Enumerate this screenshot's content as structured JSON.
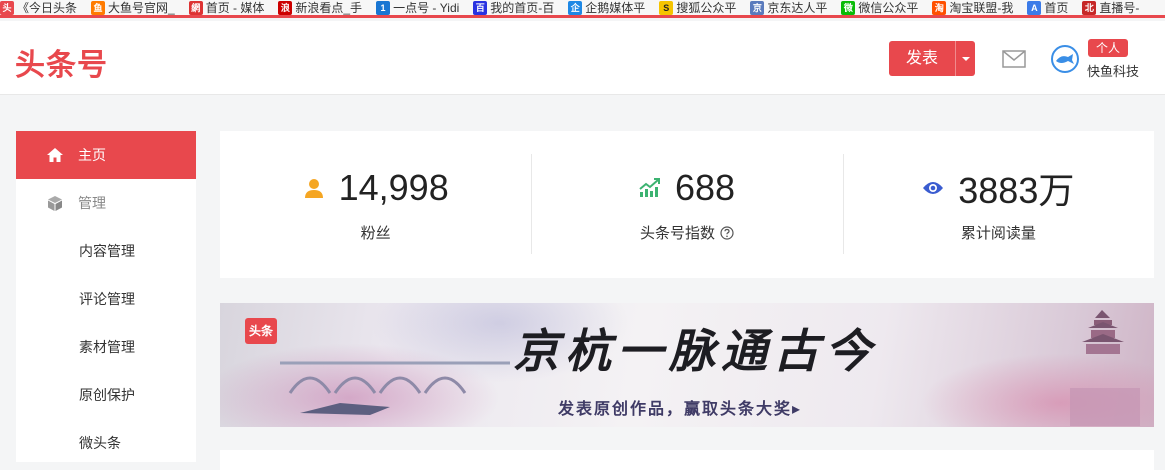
{
  "bookmarks": [
    {
      "label": "《今日头条",
      "color": "#e8484d",
      "glyph": "头"
    },
    {
      "label": "大鱼号官网_",
      "color": "#ff7b00",
      "glyph": "鱼"
    },
    {
      "label": "首页 - 媒体",
      "color": "#d33",
      "glyph": "網"
    },
    {
      "label": "新浪看点_手",
      "color": "#c00",
      "glyph": "浪"
    },
    {
      "label": "一点号 - Yidi",
      "color": "#1976d2",
      "glyph": "1"
    },
    {
      "label": "我的首页-百",
      "color": "#2932e1",
      "glyph": "百"
    },
    {
      "label": "企鹅媒体平",
      "color": "#1e88e5",
      "glyph": "企"
    },
    {
      "label": "搜狐公众平",
      "color": "#f5c400",
      "glyph": "S"
    },
    {
      "label": "京东达人平",
      "color": "#5a7bbd",
      "glyph": "京"
    },
    {
      "label": "微信公众平",
      "color": "#09bb07",
      "glyph": "微"
    },
    {
      "label": "淘宝联盟-我",
      "color": "#ff5000",
      "glyph": "淘"
    },
    {
      "label": "首页",
      "color": "#3b7be8",
      "glyph": "A"
    },
    {
      "label": "直播号-",
      "color": "#c62828",
      "glyph": "北"
    }
  ],
  "header": {
    "logo": "头条号",
    "publish_label": "发表",
    "badge": "个人",
    "account_name": "快鱼科技"
  },
  "sidebar": {
    "items": [
      {
        "label": "主页",
        "active": true
      },
      {
        "label": "管理"
      },
      {
        "label": "内容管理"
      },
      {
        "label": "评论管理"
      },
      {
        "label": "素材管理"
      },
      {
        "label": "原创保护"
      },
      {
        "label": "微头条"
      }
    ]
  },
  "stats": [
    {
      "value": "14,998",
      "label": "粉丝",
      "icon": "user-icon",
      "color": "#f5a623"
    },
    {
      "value": "688",
      "label": "头条号指数",
      "icon": "trend-chart-icon",
      "color": "#3cb371"
    },
    {
      "value": "3883万",
      "label": "累计阅读量",
      "icon": "eye-icon",
      "color": "#3a5cd0"
    }
  ],
  "banner": {
    "logo_text": "头条",
    "title": "京杭一脉通古今",
    "subtitle": "发表原创作品，赢取头条大奖▸"
  },
  "colors": {
    "accent": "#e8484d"
  }
}
